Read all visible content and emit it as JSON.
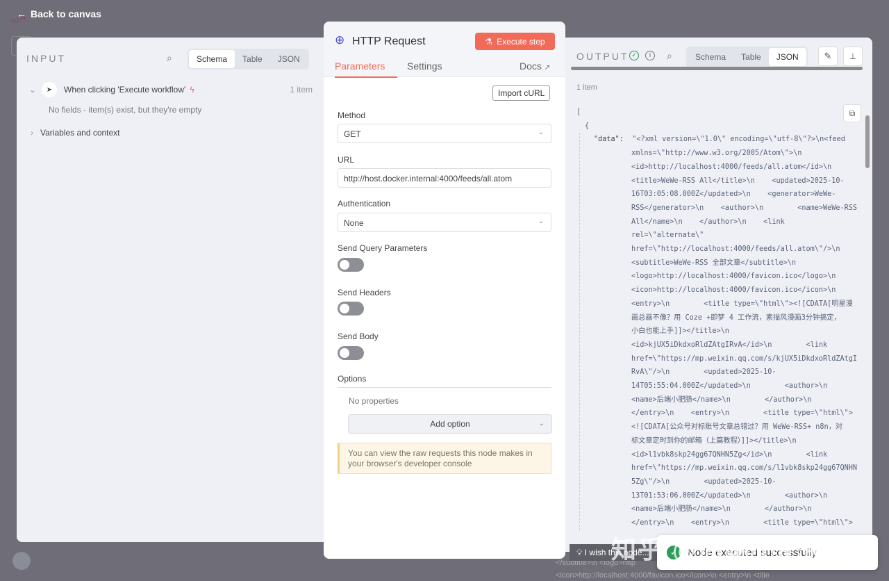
{
  "top": {
    "back_label": "Back to canvas"
  },
  "input": {
    "title": "INPUT",
    "views": [
      "Schema",
      "Table",
      "JSON"
    ],
    "active_view": "Schema",
    "trigger_name": "When clicking 'Execute workflow'",
    "trigger_count": "1 item",
    "empty_msg": "No fields - item(s) exist, but they're empty",
    "variables_label": "Variables and context"
  },
  "node": {
    "title": "HTTP Request",
    "execute_label": "Execute step",
    "tabs": [
      "Parameters",
      "Settings"
    ],
    "docs_label": "Docs",
    "import_curl": "Import cURL",
    "method_label": "Method",
    "method_value": "GET",
    "url_label": "URL",
    "url_value": "http://host.docker.internal:4000/feeds/all.atom",
    "auth_label": "Authentication",
    "auth_value": "None",
    "send_query_label": "Send Query Parameters",
    "send_query": false,
    "send_headers_label": "Send Headers",
    "send_headers": false,
    "send_body_label": "Send Body",
    "send_body": false,
    "options_label": "Options",
    "no_properties": "No properties",
    "add_option": "Add option",
    "notice": "You can view the raw requests this node makes in your browser's developer console",
    "accent": "#f26b59"
  },
  "output": {
    "title": "OUTPUT",
    "views": [
      "Schema",
      "Table",
      "JSON"
    ],
    "active_view": "JSON",
    "count": "1 item",
    "json_open": "[",
    "obj_open": "{",
    "key": "\"data\":",
    "lines": [
      "\"<?xml version=\\\"1.0\\\" encoding=\\\"utf-8\\\"?>\\n<feed",
      "xmlns=\\\"http://www.w3.org/2005/Atom\\\">\\n",
      "<id>http://localhost:4000/feeds/all.atom</id>\\n",
      "<title>WeWe-RSS All</title>\\n    <updated>2025-10-",
      "16T03:05:08.000Z</updated>\\n    <generator>WeWe-",
      "RSS</generator>\\n    <author>\\n        <name>WeWe-RSS",
      "All</name>\\n    </author>\\n    <link",
      "rel=\\\"alternate\\\"",
      "href=\\\"http://localhost:4000/feeds/all.atom\\\"/>\\n",
      "<subtitle>WeWe-RSS 全部文章</subtitle>\\n",
      "<logo>http://localhost:4000/favicon.ico</logo>\\n",
      "<icon>http://localhost:4000/favicon.ico</icon>\\n",
      "<entry>\\n        <title type=\\\"html\\\"><![CDATA[明星漫",
      "画总画不像？用 Coze +即梦 4 工作流，素描风漫画3分钟搞定，",
      "小白也能上手]]></title>\\n",
      "<id>kjUX5iDkdxoRldZAtgIRvA</id>\\n        <link",
      "href=\\\"https://mp.weixin.qq.com/s/kjUX5iDkdxoRldZAtgI",
      "RvA\\\"/>\\n        <updated>2025-10-",
      "14T05:55:04.000Z</updated>\\n        <author>\\n",
      "<name>后端小肥肠</name>\\n        </author>\\n",
      "</entry>\\n    <entry>\\n        <title type=\\\"html\\\">",
      "<![CDATA[公众号对标账号文章总错过？用 WeWe-RSS+ n8n，对",
      "标文章定时到你的邮箱（上篇教程）]]></title>\\n",
      "<id>l1vbk8skp24gg67QNHN5Zg</id>\\n        <link",
      "href=\\\"https://mp.weixin.qq.com/s/l1vbk8skp24gg67QNHN",
      "5Zg\\\"/>\\n        <updated>2025-10-",
      "13T01:53:06.000Z</updated>\\n        <author>\\n",
      "<name>后端小肥肠</name>\\n        </author>\\n",
      "</entry>\\n    <entry>\\n        <title type=\\\"html\\\">"
    ]
  },
  "toast": {
    "message": "Node executed successfully",
    "status_color": "#2f9a5a"
  },
  "feedback": {
    "label": "I wish this node..."
  },
  "watermark": "知乎 @后端小肥肠"
}
